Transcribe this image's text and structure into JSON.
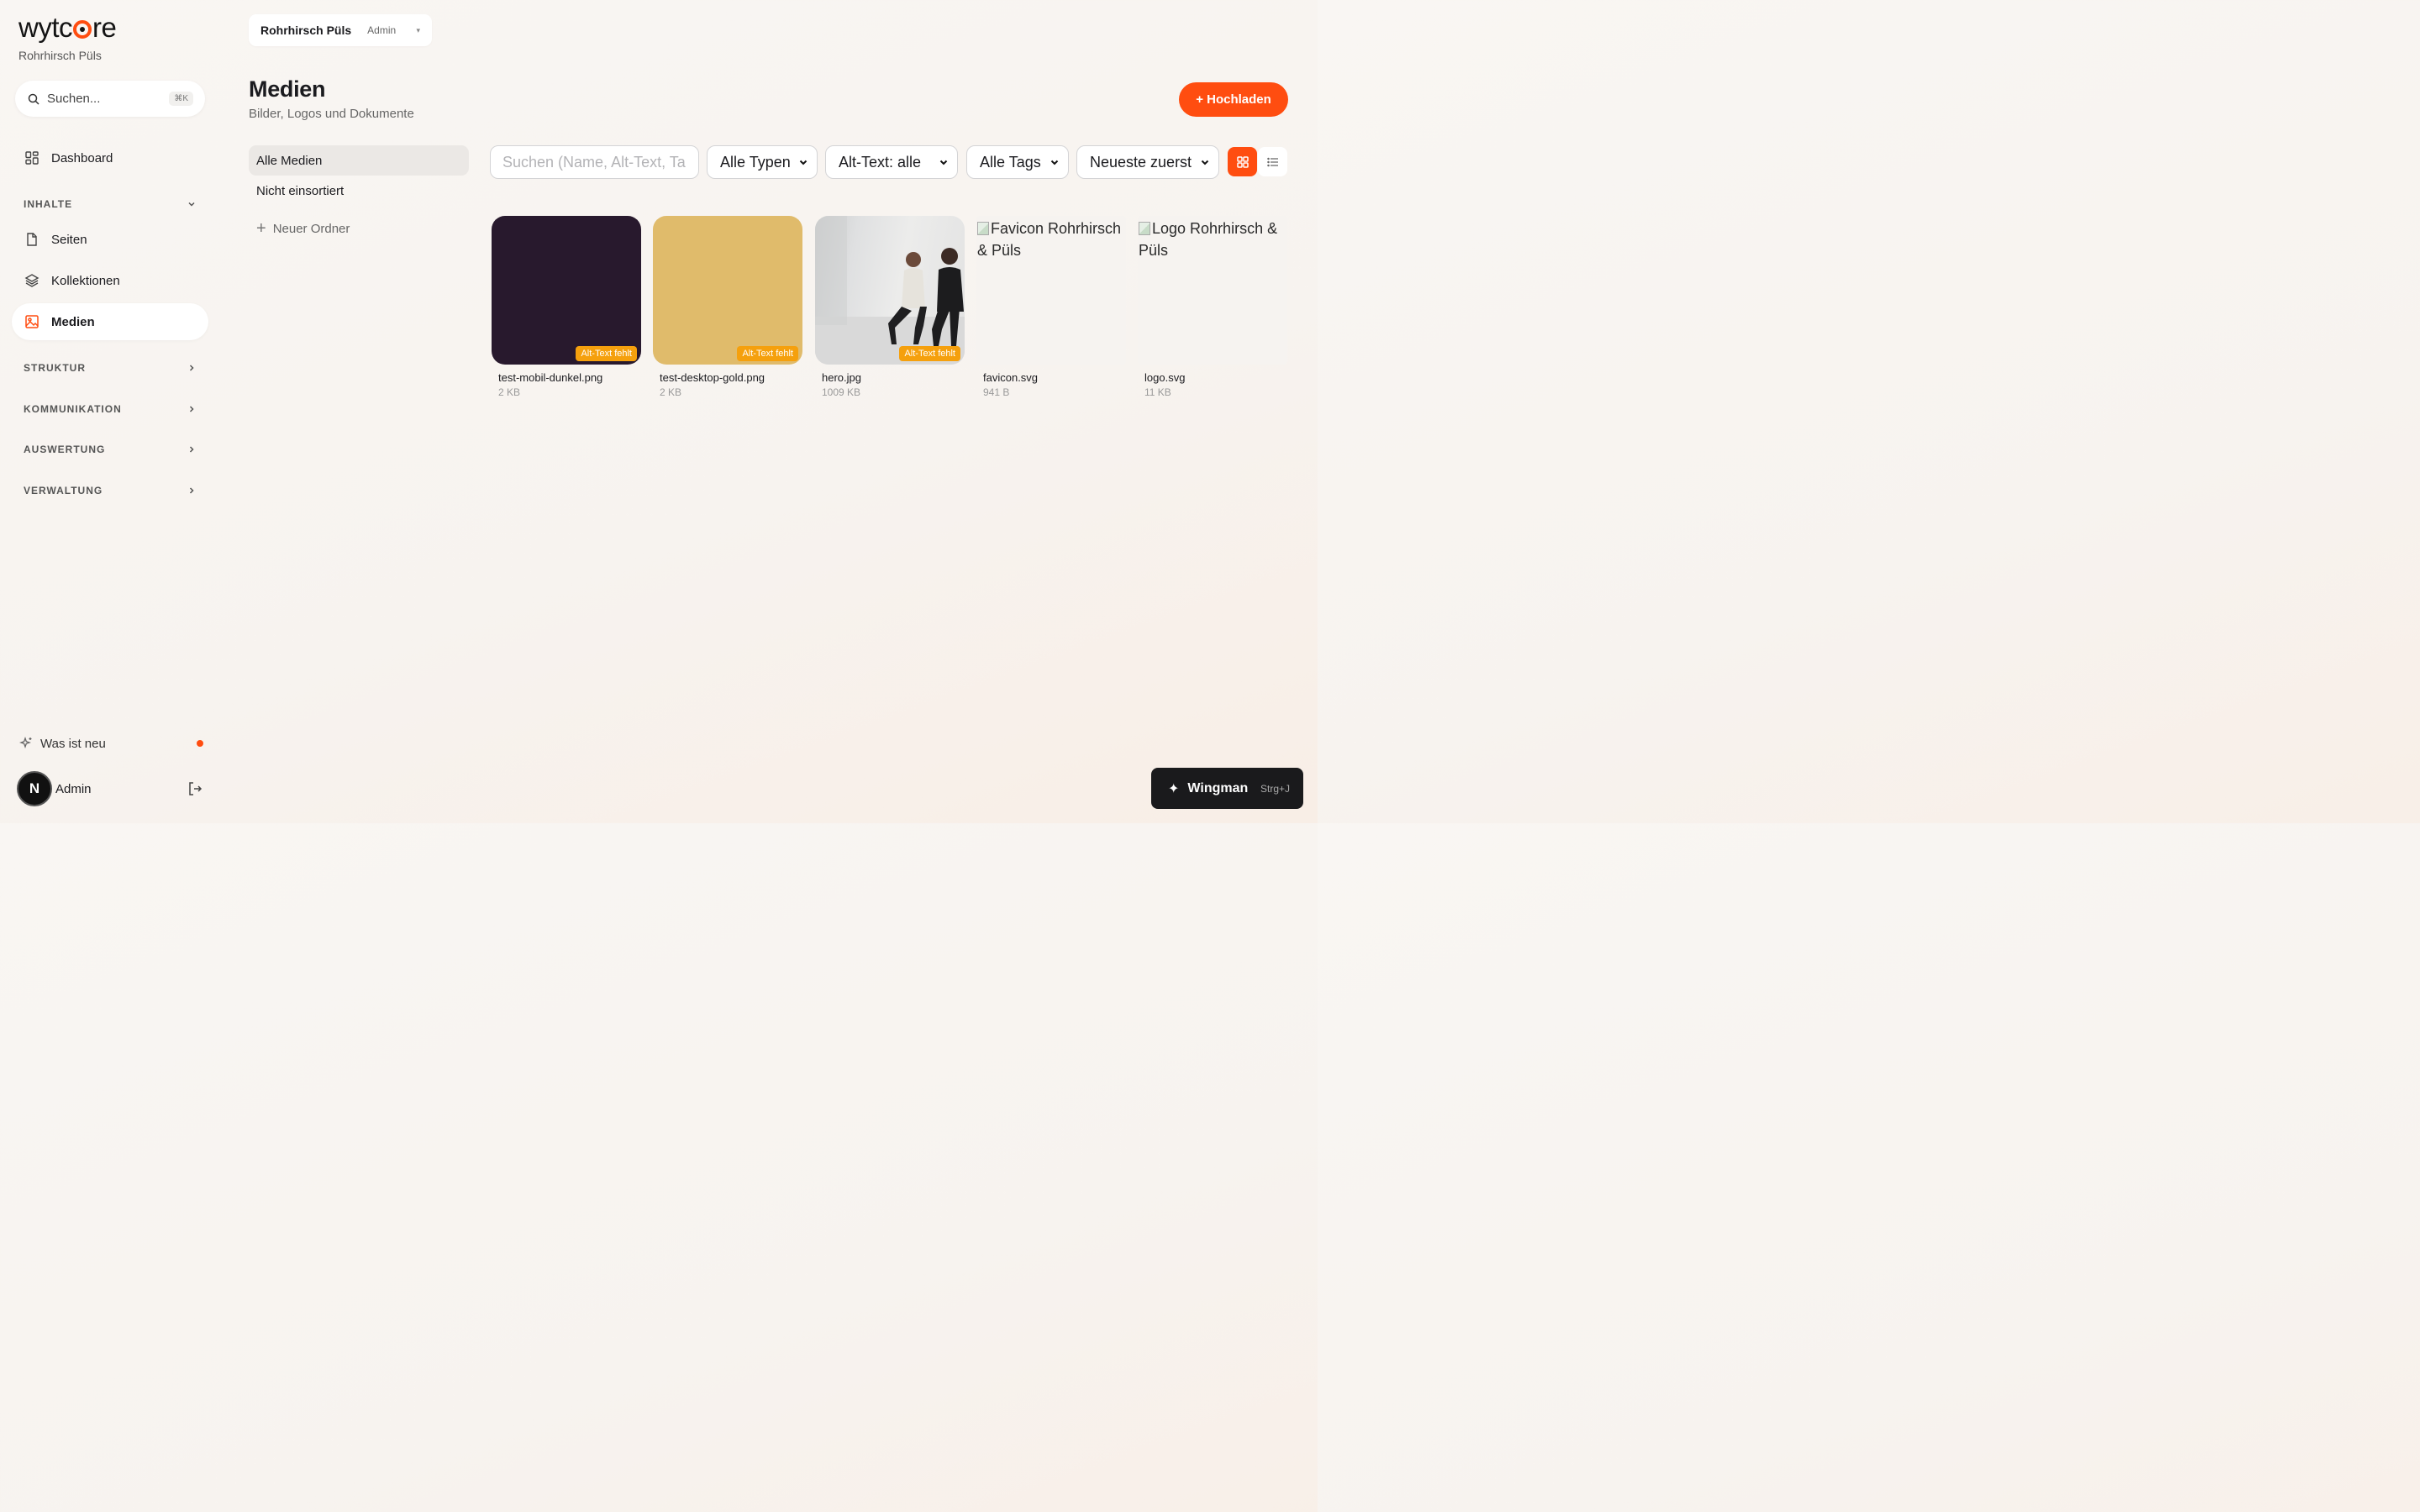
{
  "brand": {
    "logo_left": "wytc",
    "logo_right": "re",
    "org_name": "Rohrhirsch Püls",
    "accent": "#ff4d10"
  },
  "sidebar": {
    "search": {
      "placeholder": "Suchen...",
      "shortcut": "⌘K"
    },
    "dashboard": {
      "label": "Dashboard",
      "icon": "dashboard-icon"
    },
    "sections": {
      "inhalte": "INHALTE",
      "struktur": "STRUKTUR",
      "kommunikation": "KOMMUNIKATION",
      "auswertung": "AUSWERTUNG",
      "verwaltung": "VERWALTUNG"
    },
    "items": {
      "seiten": "Seiten",
      "kollektionen": "Kollektionen",
      "medien": "Medien"
    },
    "whats_new": "Was ist neu",
    "user": {
      "initial": "N",
      "name": "Admin"
    }
  },
  "header": {
    "org_switch": {
      "org": "Rohrhirsch Püls",
      "role": "Admin"
    },
    "title": "Medien",
    "subtitle": "Bilder, Logos und Dokumente",
    "upload_label": "+ Hochladen"
  },
  "folders": {
    "all": "Alle Medien",
    "unsorted": "Nicht einsortiert",
    "new_folder": "Neuer Ordner"
  },
  "filters": {
    "search_placeholder": "Suchen (Name, Alt-Text, Ta",
    "type": "Alle Typen",
    "alt_text": "Alt-Text: alle",
    "tags": "Alle Tags",
    "sort": "Neueste zuerst"
  },
  "media": [
    {
      "name": "test-mobil-dunkel.png",
      "size": "2 KB",
      "badge": "Alt-Text fehlt",
      "color": "#28192d"
    },
    {
      "name": "test-desktop-gold.png",
      "size": "2 KB",
      "badge": "Alt-Text fehlt",
      "color": "#e0bb6b"
    },
    {
      "name": "hero.jpg",
      "size": "1009 KB",
      "badge": "Alt-Text fehlt"
    },
    {
      "name": "favicon.svg",
      "size": "941 B",
      "alt": "Favicon Rohrhirsch & Püls"
    },
    {
      "name": "logo.svg",
      "size": "11 KB",
      "alt": "Logo Rohrhirsch & Püls"
    }
  ],
  "wingman": {
    "label": "Wingman",
    "shortcut": "Strg+J"
  }
}
